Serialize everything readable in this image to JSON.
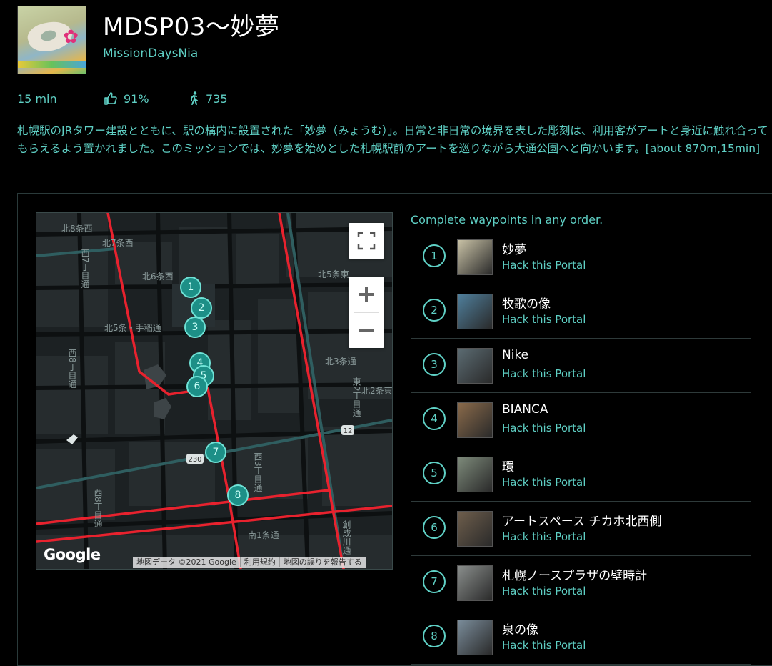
{
  "mission": {
    "title": "MDSP03～妙夢",
    "author": "MissionDaysNia",
    "stats": {
      "time": "15 min",
      "rating": "91%",
      "passes": "735"
    },
    "description": "札幌駅のJRタワー建設とともに、駅の構内に設置された「妙夢（みょうむ）」。日常と非日常の境界を表した彫刻は、利用客がアートと身近に触れ合ってもらえるよう置かれました。このミッションでは、妙夢を始めとした札幌駅前のアートを巡りながら大通公園へと向かいます。[about 870m,15min]"
  },
  "map": {
    "streets": [
      "北8条西",
      "北7条西",
      "北6条西",
      "北5条東",
      "北5条・手稲通",
      "北3条通",
      "北2条東",
      "西7丁目通",
      "西8丁目通",
      "西3丁目通",
      "西8丁目通",
      "東2丁目通",
      "南1条通",
      "創成川通"
    ],
    "road_badges": [
      "230",
      "12"
    ],
    "markers": [
      "1",
      "2",
      "3",
      "4",
      "5",
      "6",
      "7",
      "8"
    ],
    "google_logo": "Google",
    "attribution": [
      "地図データ ©2021 Google",
      "利用規約",
      "地図の誤りを報告する"
    ],
    "colors": {
      "route": "#e8222e",
      "marker": "#1d8f87",
      "accent": "#5fd0c5"
    }
  },
  "waypoints": {
    "header": "Complete waypoints in any order.",
    "items": [
      {
        "num": "1",
        "name": "妙夢",
        "action": "Hack this Portal",
        "thumb": "#c9c2a6"
      },
      {
        "num": "2",
        "name": "牧歌の像",
        "action": "Hack this Portal",
        "thumb": "#4f7f9c"
      },
      {
        "num": "3",
        "name": "Nike",
        "action": "Hack this Portal",
        "thumb": "#5b6b72"
      },
      {
        "num": "4",
        "name": "BIANCA",
        "action": "Hack this Portal",
        "thumb": "#8a6a4a"
      },
      {
        "num": "5",
        "name": "環",
        "action": "Hack this Portal",
        "thumb": "#7d8a7a"
      },
      {
        "num": "6",
        "name": "アートスペース チカホ北西側",
        "action": "Hack this Portal",
        "thumb": "#6e5e4c"
      },
      {
        "num": "7",
        "name": "札幌ノースプラザの壁時計",
        "action": "Hack this Portal",
        "thumb": "#8a8e8c"
      },
      {
        "num": "8",
        "name": "泉の像",
        "action": "Hack this Portal",
        "thumb": "#7a8c9a"
      }
    ]
  }
}
